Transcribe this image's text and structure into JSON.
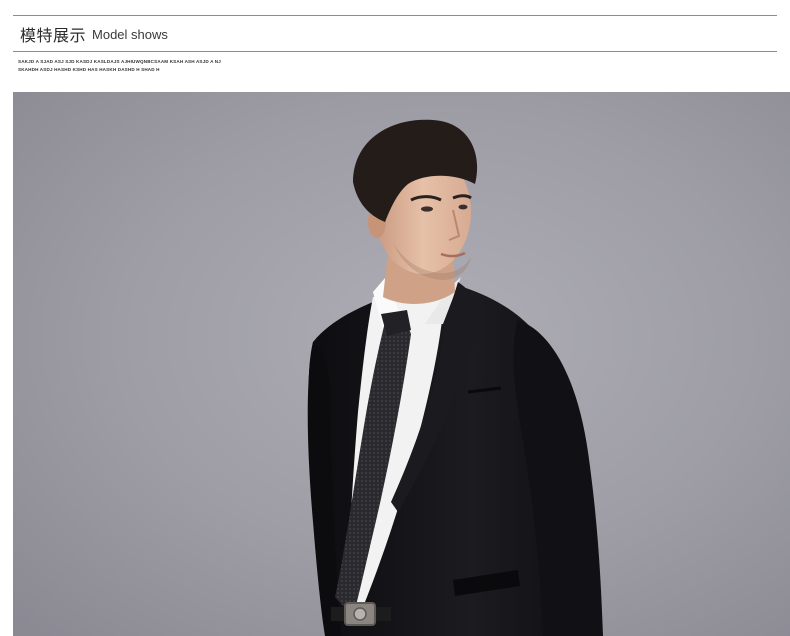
{
  "header": {
    "title_cn": "模特展示",
    "title_en": "Model shows",
    "filler_line_1": "SAKJD A SJAD ASJ SJD KASDJ KASLDAJS AJHIUWQNBCSAAM KSAH ASH ASJD A NJ",
    "filler_line_2": "SKAHDH ASDJ HASHD KSHD HAS HASKH DASHD H SHAD H"
  },
  "photo": {
    "subject": "male model in black suit, white shirt, black tie, belt with metal buckle",
    "background_color": "#9d9ca4"
  },
  "colors": {
    "rule": "#8c8c8c",
    "title_text": "#2b2b2b",
    "suit": "#141418",
    "shirt": "#f3f3f3",
    "tie": "#2a2a2e",
    "skin": "#e0b79e",
    "hair": "#231c18"
  }
}
